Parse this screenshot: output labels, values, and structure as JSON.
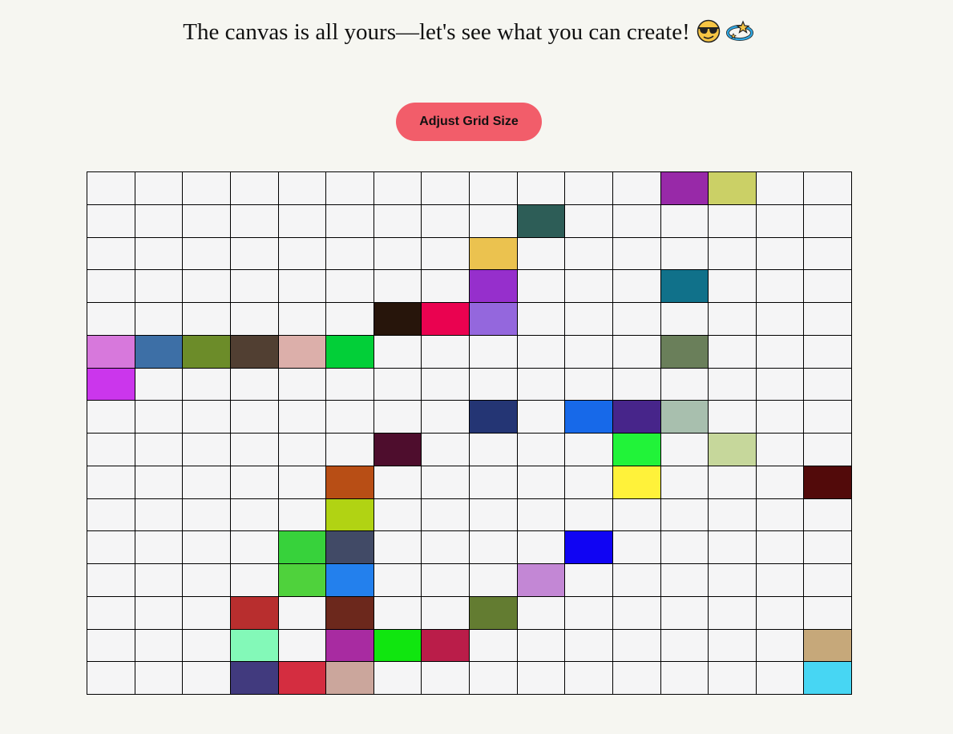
{
  "headline": "The canvas is all yours—let's see what you can create!",
  "headline_emojis": [
    "smiling-face-with-sunglasses",
    "dizzy"
  ],
  "adjust_button_label": "Adjust Grid Size",
  "grid": {
    "rows": 16,
    "cols": 16,
    "empty_color": "#f5f5f6",
    "line_color": "#000000",
    "painted": [
      {
        "r": 0,
        "c": 12,
        "color": "#9829a8"
      },
      {
        "r": 0,
        "c": 13,
        "color": "#cbd066"
      },
      {
        "r": 1,
        "c": 9,
        "color": "#2d5d57"
      },
      {
        "r": 2,
        "c": 8,
        "color": "#ebc24f"
      },
      {
        "r": 3,
        "c": 8,
        "color": "#962fcc"
      },
      {
        "r": 3,
        "c": 12,
        "color": "#10718a"
      },
      {
        "r": 4,
        "c": 6,
        "color": "#27150b"
      },
      {
        "r": 4,
        "c": 7,
        "color": "#ea0250"
      },
      {
        "r": 4,
        "c": 8,
        "color": "#9467dd"
      },
      {
        "r": 5,
        "c": 0,
        "color": "#d778dc"
      },
      {
        "r": 5,
        "c": 1,
        "color": "#3d6fa6"
      },
      {
        "r": 5,
        "c": 2,
        "color": "#6c8c29"
      },
      {
        "r": 5,
        "c": 3,
        "color": "#513f32"
      },
      {
        "r": 5,
        "c": 4,
        "color": "#dcafaa"
      },
      {
        "r": 5,
        "c": 5,
        "color": "#02cf38"
      },
      {
        "r": 5,
        "c": 12,
        "color": "#6a7f5a"
      },
      {
        "r": 6,
        "c": 0,
        "color": "#cb36ec"
      },
      {
        "r": 7,
        "c": 8,
        "color": "#243574"
      },
      {
        "r": 7,
        "c": 10,
        "color": "#1769e9"
      },
      {
        "r": 7,
        "c": 11,
        "color": "#47258a"
      },
      {
        "r": 7,
        "c": 12,
        "color": "#a8bfae"
      },
      {
        "r": 8,
        "c": 6,
        "color": "#4e0d2d"
      },
      {
        "r": 8,
        "c": 11,
        "color": "#21f339"
      },
      {
        "r": 8,
        "c": 13,
        "color": "#c6d79b"
      },
      {
        "r": 9,
        "c": 5,
        "color": "#b84e15"
      },
      {
        "r": 9,
        "c": 11,
        "color": "#fff23a"
      },
      {
        "r": 9,
        "c": 15,
        "color": "#520a0a"
      },
      {
        "r": 10,
        "c": 5,
        "color": "#b1d313"
      },
      {
        "r": 11,
        "c": 4,
        "color": "#37d23b"
      },
      {
        "r": 11,
        "c": 5,
        "color": "#414a66"
      },
      {
        "r": 11,
        "c": 10,
        "color": "#1004f3"
      },
      {
        "r": 12,
        "c": 4,
        "color": "#4fd23c"
      },
      {
        "r": 12,
        "c": 5,
        "color": "#2380ed"
      },
      {
        "r": 12,
        "c": 9,
        "color": "#c387d5"
      },
      {
        "r": 13,
        "c": 3,
        "color": "#b82e2e"
      },
      {
        "r": 13,
        "c": 5,
        "color": "#6c281c"
      },
      {
        "r": 13,
        "c": 8,
        "color": "#637c31"
      },
      {
        "r": 14,
        "c": 3,
        "color": "#83f9b8"
      },
      {
        "r": 14,
        "c": 5,
        "color": "#a82ba1"
      },
      {
        "r": 14,
        "c": 6,
        "color": "#10e60f"
      },
      {
        "r": 14,
        "c": 7,
        "color": "#ba1d49"
      },
      {
        "r": 14,
        "c": 15,
        "color": "#c6a87a"
      },
      {
        "r": 15,
        "c": 3,
        "color": "#413a7e"
      },
      {
        "r": 15,
        "c": 4,
        "color": "#d42d40"
      },
      {
        "r": 15,
        "c": 5,
        "color": "#cba69c"
      },
      {
        "r": 15,
        "c": 15,
        "color": "#47d6f3"
      }
    ]
  }
}
